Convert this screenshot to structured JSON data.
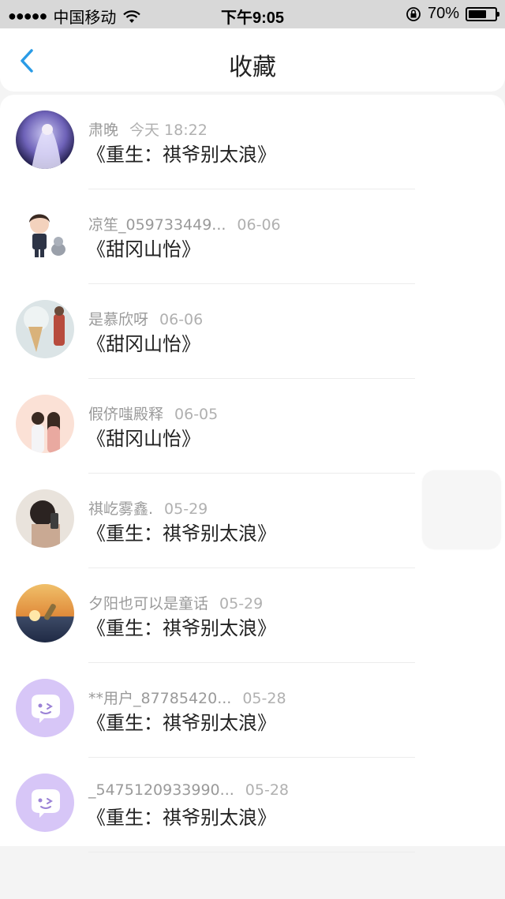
{
  "status_bar": {
    "signal_dots": "●●●●●",
    "carrier": "中国移动",
    "time": "下午9:05",
    "battery_percent": "70%",
    "battery_level": 0.7
  },
  "nav": {
    "title": "收藏"
  },
  "items": [
    {
      "user": "肃晚",
      "date": "今天 18:22",
      "title": "《重生：祺爷别太浪》",
      "avatar": "photo-girl-anime"
    },
    {
      "user": "凉笙_059733449...",
      "date": "06-06",
      "title": "《甜冈山怡》",
      "avatar": "cartoon-boy-with-cat"
    },
    {
      "user": "是慕欣呀",
      "date": "06-06",
      "title": "《甜冈山怡》",
      "avatar": "ice-cream-photo"
    },
    {
      "user": "假侪嗤殿释",
      "date": "06-05",
      "title": "《甜冈山怡》",
      "avatar": "couple-illustration"
    },
    {
      "user": "祺屹雾鑫.",
      "date": "05-29",
      "title": "《重生：祺爷别太浪》",
      "avatar": "boy-selfie-photo"
    },
    {
      "user": "夕阳也可以是童话",
      "date": "05-29",
      "title": "《重生：祺爷别太浪》",
      "avatar": "sunset-bottle-photo"
    },
    {
      "user": "**用户_87785420...",
      "date": "05-28",
      "title": "《重生：祺爷别太浪》",
      "avatar": "default-chat-icon"
    },
    {
      "user": "_5475120933990...",
      "date": "05-28",
      "title": "《重生：祺爷别太浪》",
      "avatar": "default-chat-icon"
    }
  ]
}
